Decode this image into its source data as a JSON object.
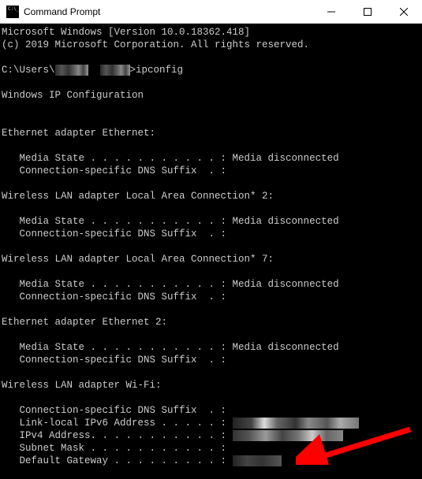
{
  "titlebar": {
    "title": "Command Prompt"
  },
  "terminal": {
    "banner1": "Microsoft Windows [Version 10.0.18362.418]",
    "banner2": "(c) 2019 Microsoft Corporation. All rights reserved.",
    "prompt_prefix": "C:\\Users\\",
    "prompt_suffix": ">ipconfig",
    "header": "Windows IP Configuration",
    "adapters": [
      {
        "name": "Ethernet adapter Ethernet:",
        "lines": [
          "   Media State . . . . . . . . . . . : Media disconnected",
          "   Connection-specific DNS Suffix  . :"
        ]
      },
      {
        "name": "Wireless LAN adapter Local Area Connection* 2:",
        "lines": [
          "   Media State . . . . . . . . . . . : Media disconnected",
          "   Connection-specific DNS Suffix  . :"
        ]
      },
      {
        "name": "Wireless LAN adapter Local Area Connection* 7:",
        "lines": [
          "   Media State . . . . . . . . . . . : Media disconnected",
          "   Connection-specific DNS Suffix  . :"
        ]
      },
      {
        "name": "Ethernet adapter Ethernet 2:",
        "lines": [
          "   Media State . . . . . . . . . . . : Media disconnected",
          "   Connection-specific DNS Suffix  . :"
        ]
      }
    ],
    "wifi_adapter": {
      "name": "Wireless LAN adapter Wi-Fi:",
      "dns_line": "   Connection-specific DNS Suffix  . :",
      "ipv6_label": "   Link-local IPv6 Address . . . . . : ",
      "ipv4_label": "   IPv4 Address. . . . . . . . . . . : ",
      "subnet_label": "   Subnet Mask . . . . . . . . . . . : ",
      "gateway_label": "   Default Gateway . . . . . . . . . : "
    }
  }
}
